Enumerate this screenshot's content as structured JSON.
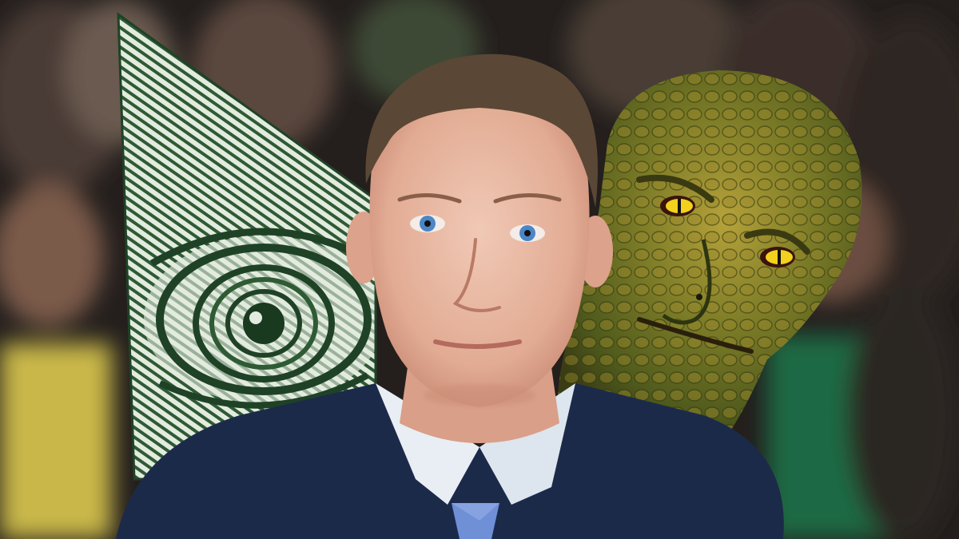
{
  "image": {
    "colors": {
      "background_dark": "#1e1b1a",
      "crowd_blur": "#3a2f2a",
      "yellow_clothing": "#c9b84a",
      "green_clothing": "#1f6b44",
      "pyramid_green": "#2f5a36",
      "pyramid_light": "#dfe8dc",
      "suit_navy": "#1c2a4a",
      "shirt_white": "#e8eef4",
      "tie_blue": "#6f8fd6",
      "skin": "#e6b5a0",
      "hair": "#5b4736",
      "eyes_blue": "#4b86c7",
      "reptile_green": "#6f7a2a",
      "reptile_gold": "#b08a2c",
      "reptile_eye": "#f2d21c"
    }
  }
}
